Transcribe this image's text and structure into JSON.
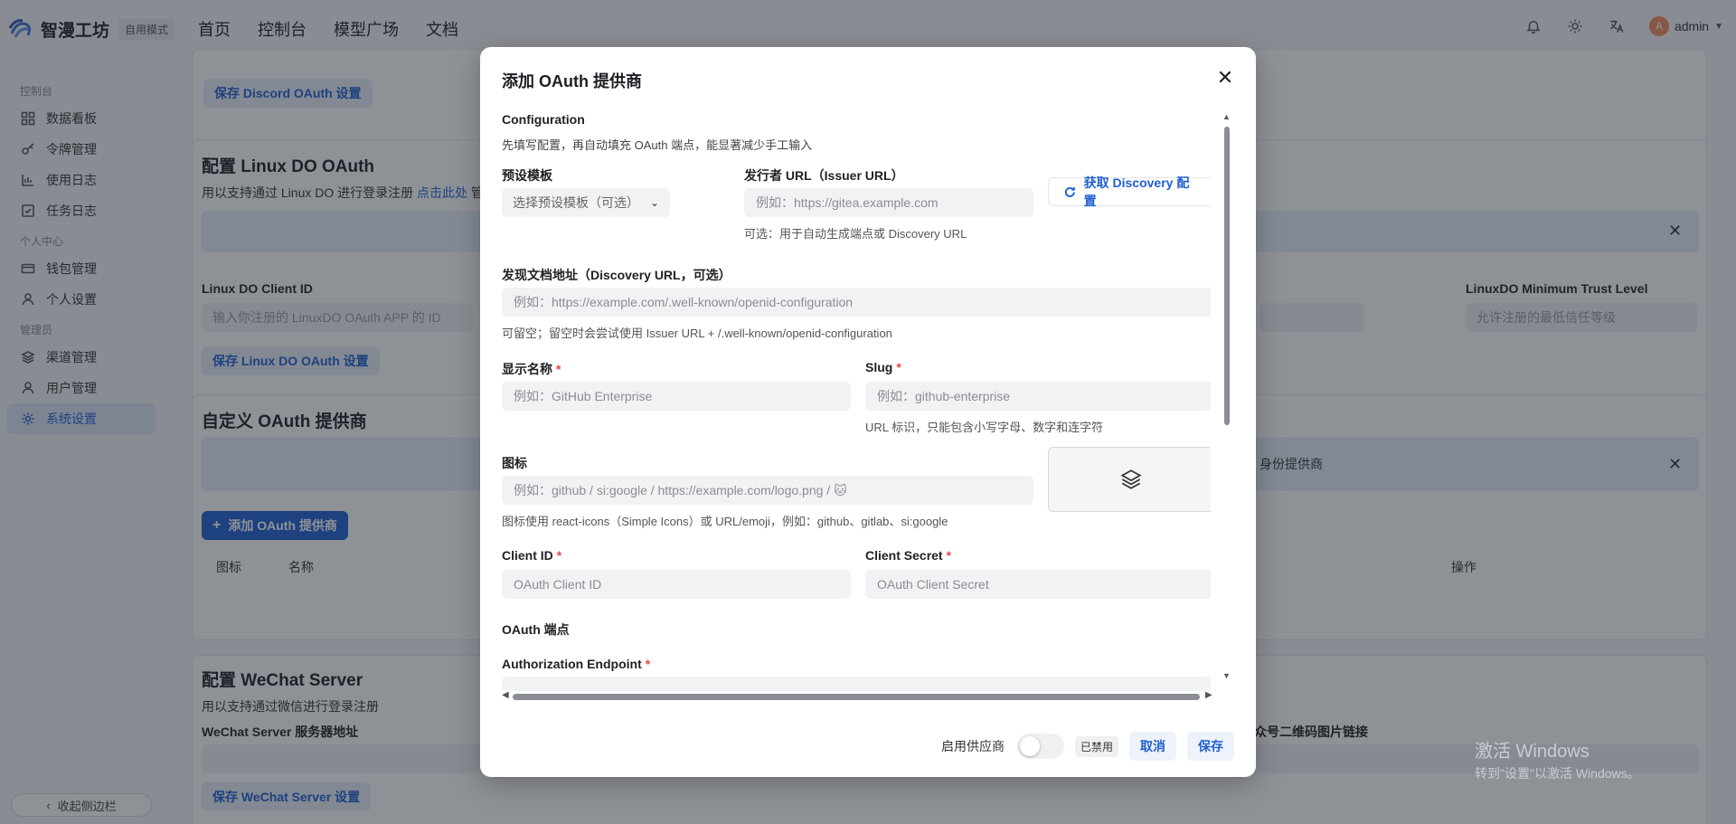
{
  "topbar": {
    "brand": "智漫工坊",
    "mode": "自用模式",
    "nav": [
      "首页",
      "控制台",
      "模型广场",
      "文档"
    ],
    "username": "admin",
    "avatar_letter": "A"
  },
  "sidebar": {
    "groups": {
      "console": "控制台",
      "personal": "个人中心",
      "admin": "管理员"
    },
    "items": {
      "dashboard": "数据看板",
      "tokens": "令牌管理",
      "logs": "使用日志",
      "tasks": "任务日志",
      "wallet": "钱包管理",
      "profile": "个人设置",
      "channels": "渠道管理",
      "users": "用户管理",
      "settings": "系统设置"
    },
    "collapse": "收起侧边栏"
  },
  "background": {
    "discord_save": "保存 Discord OAuth 设置",
    "linuxdo_title": "配置 Linux DO OAuth",
    "linuxdo_desc": "用以支持通过 Linux DO 进行登录注册",
    "linuxdo_link": "点击此处",
    "linuxdo_desc_tail": "管",
    "linuxdo_client_id_label": "Linux DO Client ID",
    "linuxdo_client_id_placeholder": "输入你注册的 LinuxDO OAuth APP 的 ID",
    "linuxdo_trust_label": "LinuxDO Minimum Trust Level",
    "linuxdo_trust_placeholder": "允许注册的最低信任等级",
    "linuxdo_save": "保存 Linux DO OAuth 设置",
    "custom_title": "自定义 OAuth 提供商",
    "custom_alert_tail": "身份提供商",
    "add_provider": "添加 OAuth 提供商",
    "col_icon": "图标",
    "col_name": "名称",
    "col_action": "操作",
    "wechat_title": "配置 WeChat Server",
    "wechat_desc": "用以支持通过微信进行登录注册",
    "wechat_addr_label": "WeChat Server 服务器地址",
    "wechat_qr_label": "众号二维码图片链接",
    "wechat_save": "保存 WeChat Server 设置"
  },
  "modal": {
    "title": "添加 OAuth 提供商",
    "section_config": "Configuration",
    "config_desc": "先填写配置，再自动填充 OAuth 端点，能显著减少手工输入",
    "preset_label": "预设模板",
    "preset_placeholder": "选择预设模板（可选）",
    "issuer_label": "发行者 URL（Issuer URL）",
    "issuer_placeholder": "例如：https://gitea.example.com",
    "issuer_help": "可选：用于自动生成端点或 Discovery URL",
    "discovery_button": "获取 Discovery 配置",
    "discovery_label": "发现文档地址（Discovery URL，可选）",
    "discovery_placeholder": "例如：https://example.com/.well-known/openid-configuration",
    "discovery_help": "可留空；留空时会尝试使用 Issuer URL + /.well-known/openid-configuration",
    "display_name_label": "显示名称",
    "display_name_placeholder": "例如：GitHub Enterprise",
    "slug_label": "Slug",
    "slug_placeholder": "例如：github-enterprise",
    "slug_help": "URL 标识，只能包含小写字母、数字和连字符",
    "icon_label": "图标",
    "icon_placeholder": "例如：github / si:google / https://example.com/logo.png / 🐱",
    "icon_help": "图标使用 react-icons（Simple Icons）或 URL/emoji，例如：github、gitlab、si:google",
    "client_id_label": "Client ID",
    "client_id_placeholder": "OAuth Client ID",
    "client_secret_label": "Client Secret",
    "client_secret_placeholder": "OAuth Client Secret",
    "endpoints_section": "OAuth 端点",
    "auth_endpoint_label": "Authorization Endpoint",
    "required_mark": "*",
    "enable_label": "启用供应商",
    "enable_state": "已禁用",
    "cancel": "取消",
    "save": "保存"
  },
  "watermark": {
    "line1": "激活 Windows",
    "line2": "转到\"设置\"以激活 Windows。"
  },
  "colors": {
    "accent": "#1f5fd1",
    "required": "#e5484d",
    "overlay": "rgba(30,35,45,0.5)"
  }
}
